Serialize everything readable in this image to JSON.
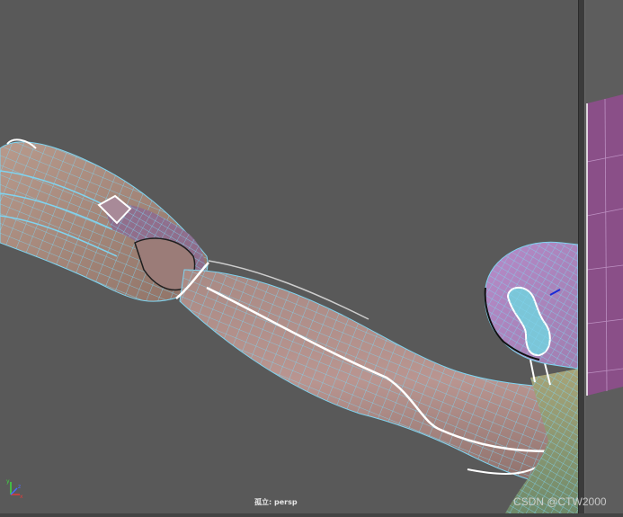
{
  "viewport": {
    "camera_label": "孤立: persp",
    "background": "#595959"
  },
  "axis_gizmo": {
    "x_label": "x",
    "y_label": "y",
    "z_label": "z"
  },
  "watermark": "CSDN @CTW2000",
  "colors": {
    "wire": "#7fd4f0",
    "skin": "#b58e86",
    "selected": "#9a6c95",
    "edge_loop": "#ffffff",
    "side_mesh": "#8a4f88"
  }
}
